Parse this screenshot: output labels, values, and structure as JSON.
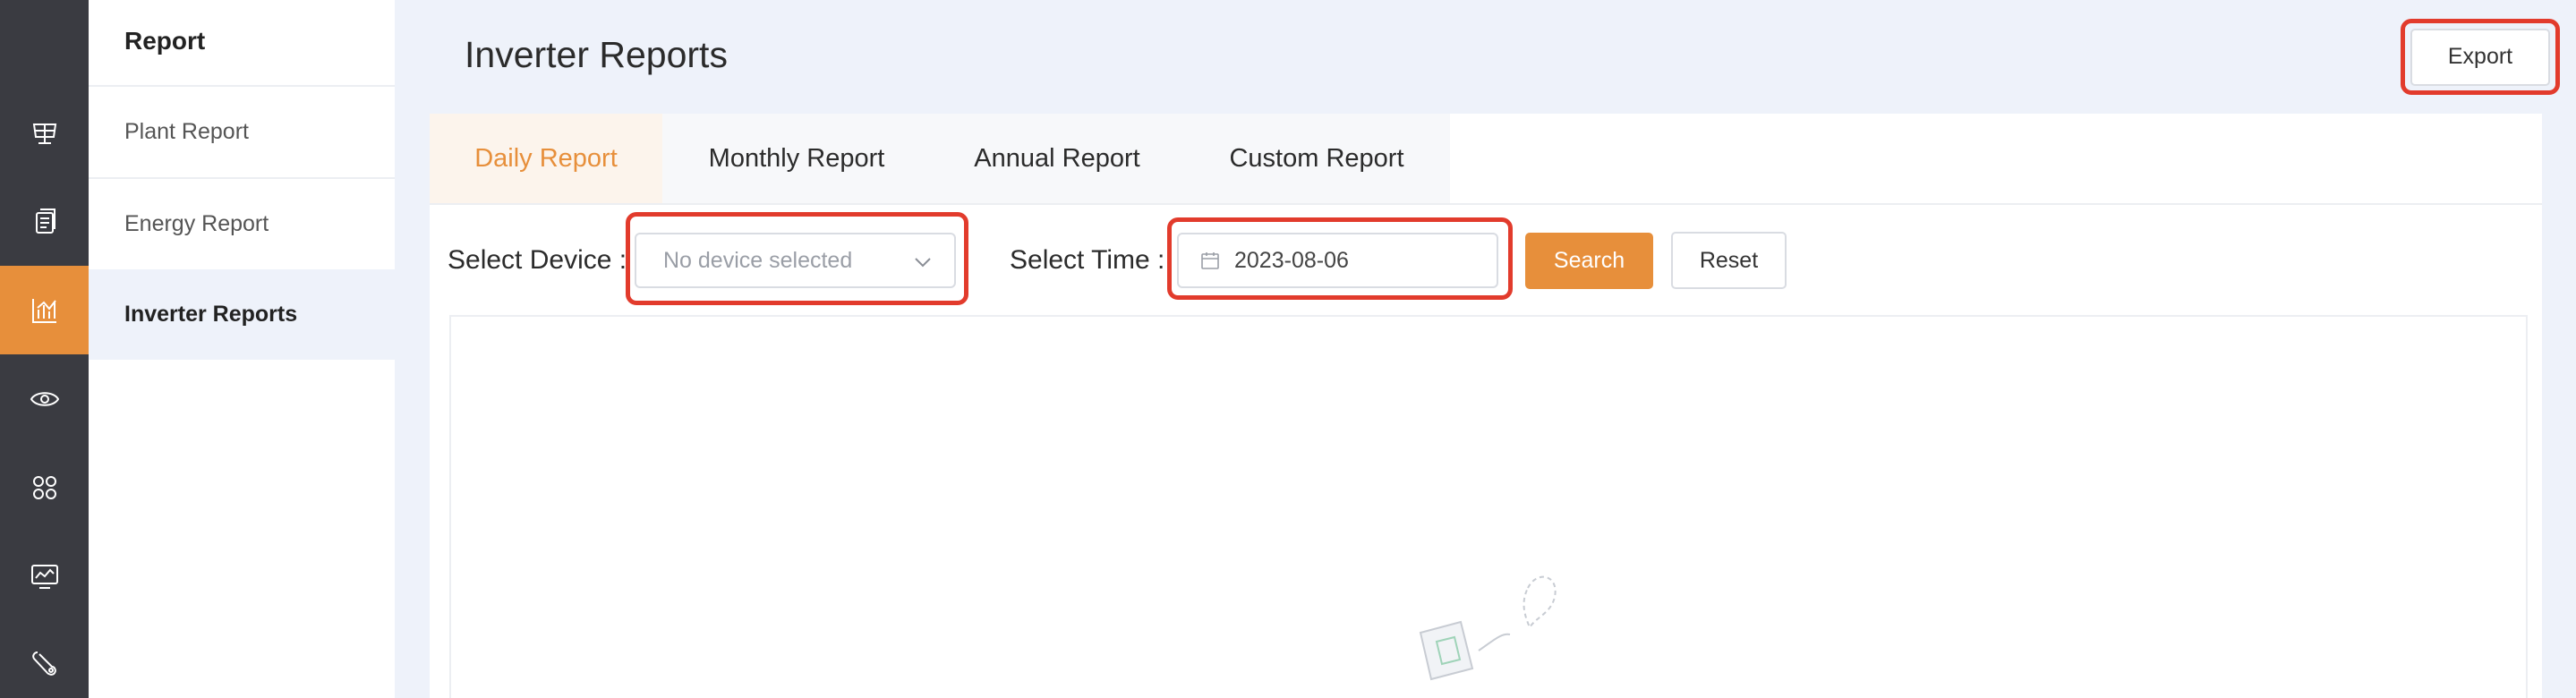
{
  "rail": {
    "items": [
      {
        "icon": "solar-panel-icon",
        "active": false
      },
      {
        "icon": "device-list-icon",
        "active": false
      },
      {
        "icon": "bar-chart-icon",
        "active": true
      },
      {
        "icon": "eye-icon",
        "active": false
      },
      {
        "icon": "apps-icon",
        "active": false
      },
      {
        "icon": "monitor-icon",
        "active": false
      },
      {
        "icon": "tools-icon",
        "active": false
      }
    ]
  },
  "subnav": {
    "title": "Report",
    "items": [
      {
        "label": "Plant Report",
        "active": false
      },
      {
        "label": "Energy Report",
        "active": false
      },
      {
        "label": "Inverter Reports",
        "active": true
      }
    ]
  },
  "header": {
    "title": "Inverter Reports",
    "export_label": "Export"
  },
  "tabs": [
    {
      "label": "Daily Report",
      "active": true
    },
    {
      "label": "Monthly Report",
      "active": false
    },
    {
      "label": "Annual Report",
      "active": false
    },
    {
      "label": "Custom Report",
      "active": false
    }
  ],
  "filters": {
    "device_label": "Select Device :",
    "device_placeholder": "No device selected",
    "time_label": "Select Time :",
    "date_value": "2023-08-06",
    "search_label": "Search",
    "reset_label": "Reset"
  },
  "colors": {
    "accent": "#e78f3b",
    "highlight": "#e23b2c",
    "rail_bg": "#3a3b41"
  }
}
